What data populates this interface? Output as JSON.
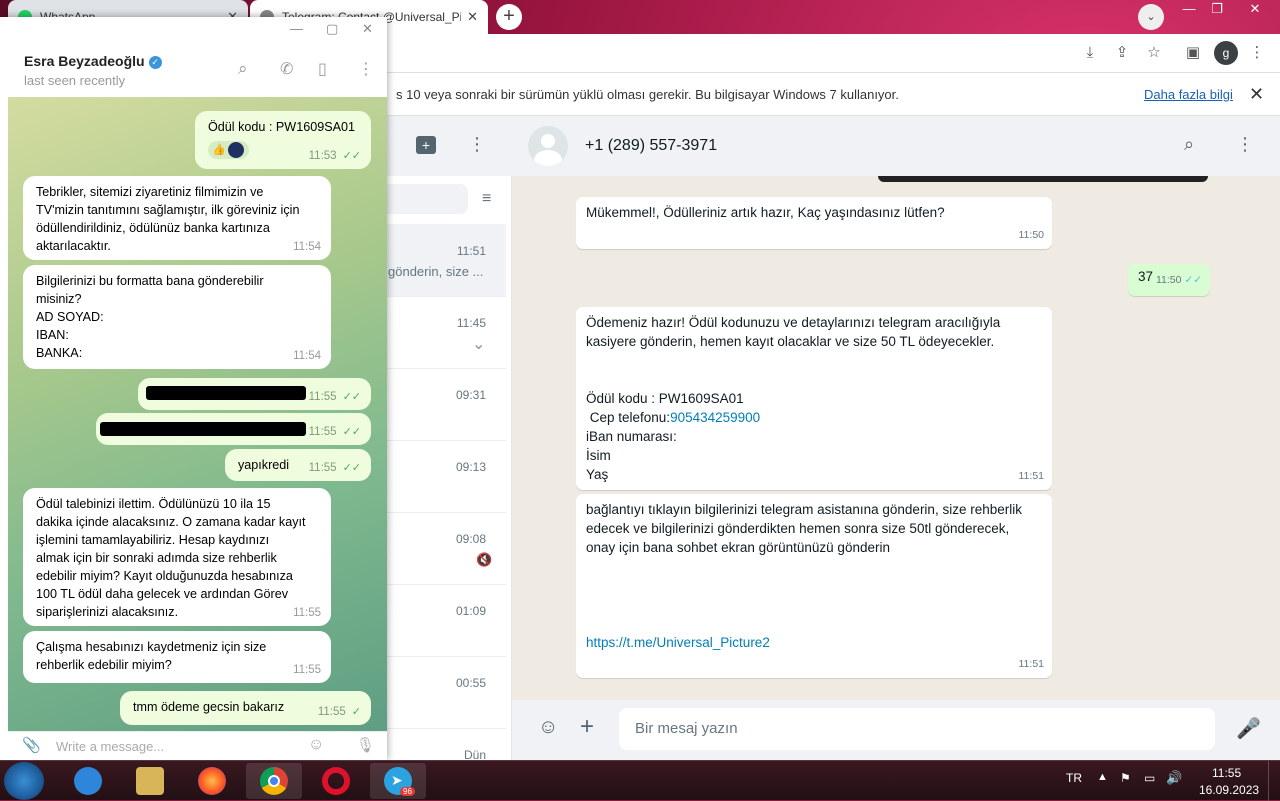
{
  "browser": {
    "tabs": [
      {
        "title": "WhatsApp",
        "active": false
      },
      {
        "title": "Telegram: Contact @Universal_Pi",
        "active": true
      }
    ],
    "profile_letter": "g",
    "infobar": {
      "text": "s 10 veya sonraki bir sürümün yüklü olması gerekir. Bu bilgisayar Windows 7 kullanıyor.",
      "link": "Daha fazla bilgi"
    }
  },
  "whatsapp": {
    "contact": "+1 (289) 557-3971",
    "chat_list_times": [
      "11:51",
      "11:45",
      "09:31",
      "09:13",
      "09:08",
      "01:09",
      "00:55",
      "Dün"
    ],
    "chat_list_preview": "gönderin, size ...",
    "messages": [
      {
        "dir": "in",
        "text": "Mükemmel!, Ödülleriniz artık hazır, Kaç yaşındasınız lütfen?",
        "time": "11:50"
      },
      {
        "dir": "out",
        "text": "37",
        "time": "11:50"
      },
      {
        "dir": "in",
        "lines": [
          "Ödemeniz hazır! Ödül kodunuzu ve detaylarınızı telegram aracılığıyla",
          "kasiyere gönderin, hemen kayıt olacaklar ve size 50 TL ödeyecekler.",
          "",
          "",
          "Ödül kodu : PW1609SA01",
          " Cep telefonu:",
          "iBan numarası:",
          "İsim",
          "Yaş"
        ],
        "phone": "905434259900",
        "time": "11:51"
      },
      {
        "dir": "in",
        "lines": [
          "bağlantıyı tıklayın bilgilerinizi telegram asistanına gönderin, size rehberlik",
          "edecek ve bilgilerinizi gönderdikten hemen sonra size 50tl gönderecek,",
          "onay için bana sohbet ekran görüntünüzü gönderin"
        ],
        "link": "https://t.me/Universal_Picture2",
        "time": "11:51"
      }
    ],
    "input_placeholder": "Bir mesaj yazın"
  },
  "telegram": {
    "contact_name": "Esra Beyzadeoğlu",
    "status": "last seen recently",
    "messages": [
      {
        "dir": "out",
        "text": "Ödül kodu : PW1609SA01",
        "time": "11:53"
      },
      {
        "dir": "in",
        "lines": [
          "Tebrikler, sitemizi ziyaretiniz filmimizin ve",
          "TV'mizin tanıtımını sağlamıştır, ilk göreviniz için",
          "ödüllendirildiniz, ödülünüz banka kartınıza",
          "aktarılacaktır."
        ],
        "time": "11:54"
      },
      {
        "dir": "in",
        "lines": [
          "Bilgilerinizi bu formatta bana gönderebilir",
          "misiniz?",
          "AD SOYAD:",
          "IBAN:",
          "BANKA:"
        ],
        "time": "11:54"
      },
      {
        "dir": "out",
        "text": "",
        "redacted": true,
        "time": "11:55"
      },
      {
        "dir": "out",
        "text": "",
        "redacted": true,
        "time": "11:55"
      },
      {
        "dir": "out",
        "text": "yapıkredi",
        "time": "11:55"
      },
      {
        "dir": "in",
        "lines": [
          "Ödül talebinizi ilettim. Ödülünüzü 10 ila 15",
          "dakika içinde alacaksınız. O zamana kadar kayıt",
          "işlemini tamamlayabiliriz. Hesap kaydınızı",
          "almak için bir sonraki adımda size rehberlik",
          "edebilir miyim? Kayıt olduğunuzda hesabınıza",
          "100 TL ödül daha gelecek ve ardından Görev",
          "siparişlerinizi alacaksınız."
        ],
        "time": "11:55"
      },
      {
        "dir": "in",
        "lines": [
          "Çalışma hesabınızı kaydetmeniz için size",
          "rehberlik edebilir miyim?"
        ],
        "time": "11:55"
      },
      {
        "dir": "out",
        "text": "tmm ödeme gecsin bakarız",
        "time": "11:55"
      }
    ],
    "input_placeholder": "Write a message..."
  },
  "taskbar": {
    "language": "TR",
    "time": "11:55",
    "date": "16.09.2023",
    "telegram_badge": "96"
  },
  "colors": {
    "wa_outgoing": "#d9fdd3",
    "tg_outgoing": "#effdde",
    "tg_check": "#4fae4e",
    "link": "#027eb5"
  }
}
